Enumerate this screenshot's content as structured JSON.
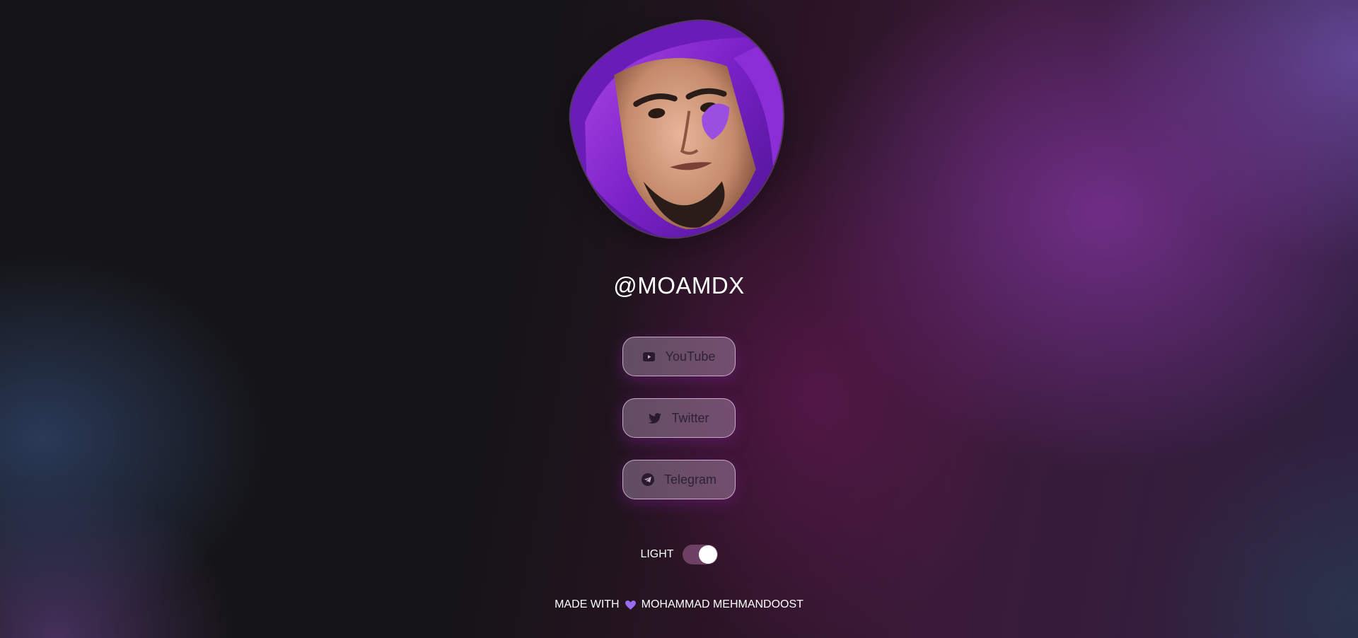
{
  "profile": {
    "handle": "@MOAMDX",
    "avatar_icon": "avatar-portrait"
  },
  "links": [
    {
      "label": "YouTube",
      "icon": "youtube-icon"
    },
    {
      "label": "Twitter",
      "icon": "twitter-icon"
    },
    {
      "label": "Telegram",
      "icon": "telegram-icon"
    }
  ],
  "theme": {
    "label": "LIGHT",
    "toggle_on": true
  },
  "footer": {
    "made_with": "MADE WITH",
    "author": "MOHAMMAD MEHMANDOOST",
    "heart_icon": "heart-icon"
  },
  "colors": {
    "accent": "#9b5de5",
    "button_text": "#2f2234",
    "heart": "#9a6cf0"
  }
}
